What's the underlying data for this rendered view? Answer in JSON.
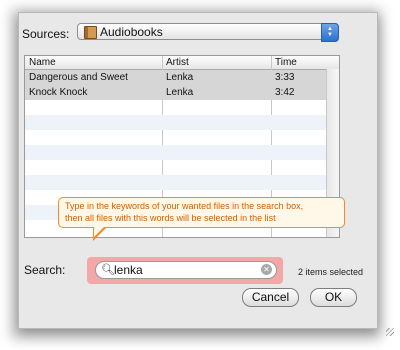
{
  "sources": {
    "label": "Sources:",
    "value": "Audiobooks",
    "icon": "audiobook-icon"
  },
  "table": {
    "columns": [
      "Name",
      "Artist",
      "Time"
    ],
    "rows": [
      {
        "name": "Dangerous and Sweet",
        "artist": "Lenka",
        "time": "3:33"
      },
      {
        "name": "Knock Knock",
        "artist": "Lenka",
        "time": "3:42"
      }
    ]
  },
  "callout": {
    "line1": "Type in the keywords of your wanted files in the search box,",
    "line2": "then all files with this words will be selected in the list"
  },
  "search": {
    "label": "Search:",
    "value": "lenka",
    "status": "2 items selected"
  },
  "buttons": {
    "cancel": "Cancel",
    "ok": "OK"
  },
  "colors": {
    "callout_border": "#f28c28",
    "callout_text": "#d06000",
    "search_highlight": "#f3a7a7",
    "popup_arrow": "#2d6fd1"
  }
}
